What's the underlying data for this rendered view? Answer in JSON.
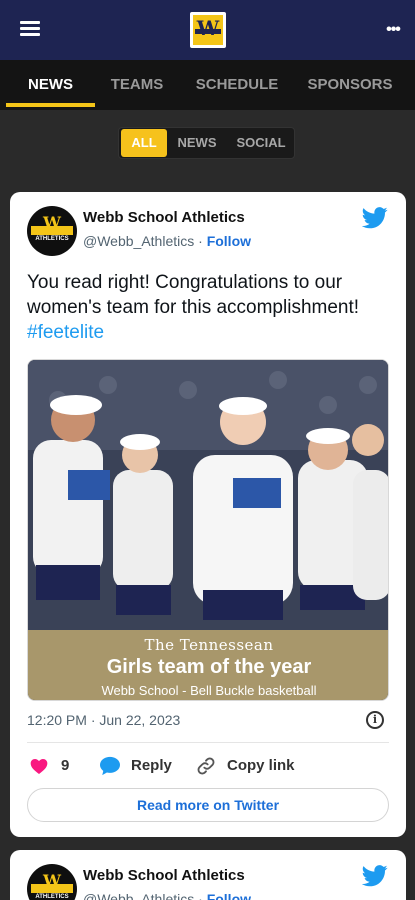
{
  "header": {
    "menu_icon": "hamburger-menu-icon",
    "logo": "school-logo",
    "more_icon": "ellipsis-icon"
  },
  "tabs": [
    {
      "label": "NEWS",
      "active": true
    },
    {
      "label": "TEAMS",
      "active": false
    },
    {
      "label": "SCHEDULE",
      "active": false
    },
    {
      "label": "SPONSORS",
      "active": false
    }
  ],
  "filter": [
    {
      "label": "ALL",
      "active": true
    },
    {
      "label": "NEWS",
      "active": false
    },
    {
      "label": "SOCIAL",
      "active": false
    }
  ],
  "posts": [
    {
      "author": "Webb School Athletics",
      "handle": "@Webb_Athletics",
      "follow_label": "Follow",
      "text": "You read right! Congratulations to our women's team for this accomplishment!",
      "hashtag": "#feetelite",
      "media": {
        "publication": "The Tennessean",
        "headline": "Girls team of the year",
        "subline": "Webb School - Bell Buckle basketball"
      },
      "timestamp": "12:20 PM · Jun 22, 2023",
      "likes": "9",
      "reply_label": "Reply",
      "copy_label": "Copy link",
      "read_more_label": "Read more on Twitter"
    },
    {
      "author": "Webb School Athletics",
      "handle": "@Webb_Athletics",
      "follow_label": "Follow"
    }
  ],
  "colors": {
    "navy": "#1e2452",
    "gold": "#f4c518",
    "link": "#1d6fd8",
    "like": "#f91880"
  }
}
